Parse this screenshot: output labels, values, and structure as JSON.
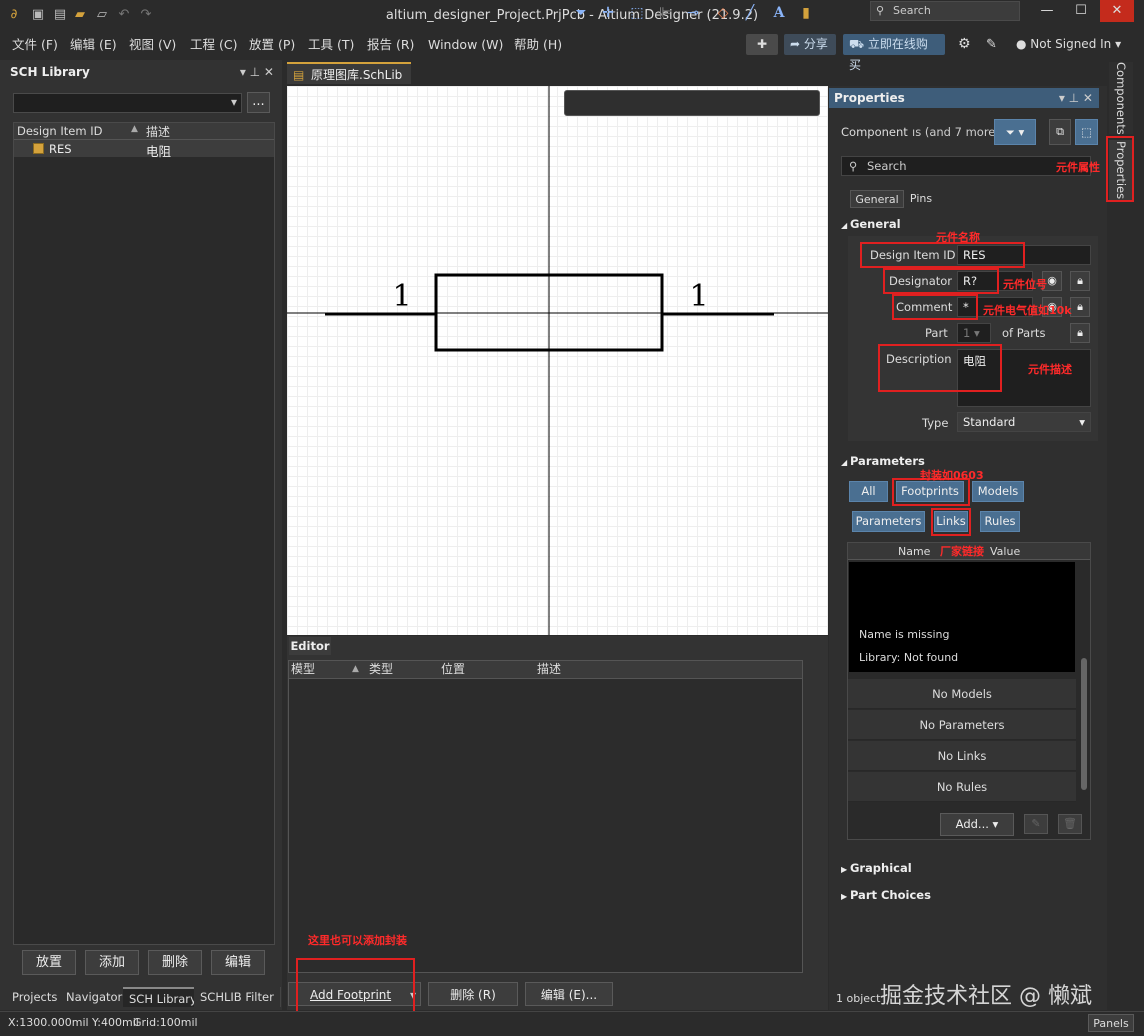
{
  "window": {
    "title": "altium_designer_Project.PrjPcb - Altium Designer (21.9.2)",
    "search_placeholder": "Search"
  },
  "menu": [
    "文件 (F)",
    "编辑 (E)",
    "视图 (V)",
    "工程 (C)",
    "放置 (P)",
    "工具 (T)",
    "报告 (R)",
    "Window (W)",
    "帮助 (H)"
  ],
  "toolbar": {
    "share": "分享",
    "buy": "立即在线购买",
    "user": "Not Signed In"
  },
  "left_panel": {
    "title": "SCH Library",
    "more_button": "...",
    "columns": [
      "Design Item ID",
      "描述"
    ],
    "rows": [
      {
        "id": "RES",
        "desc": "电阻"
      }
    ],
    "buttons": [
      "放置",
      "添加",
      "删除",
      "编辑"
    ],
    "tabs": [
      "Projects",
      "Navigator",
      "SCH Library",
      "SCHLIB Filter"
    ]
  },
  "document": {
    "tab": "原理图库.SchLib *",
    "pin_left": "1",
    "pin_right": "1"
  },
  "editor": {
    "tab": "Editor",
    "columns": [
      "模型",
      "类型",
      "位置",
      "描述"
    ],
    "add_footprint": "Add Footprint",
    "delete": "删除 (R)",
    "edit": "编辑 (E)..."
  },
  "properties": {
    "title": "Properties",
    "component_label": "Component",
    "component_filter": "ıs (and 7 more)",
    "search": "Search",
    "tabs": [
      "General",
      "Pins"
    ],
    "general_header": "General",
    "design_item_id_label": "Design Item ID",
    "design_item_id": "RES",
    "designator_label": "Designator",
    "designator": "R?",
    "comment_label": "Comment",
    "comment": "*",
    "part_label": "Part",
    "part_value": "1",
    "of_parts": "of Parts",
    "description_label": "Description",
    "description": "电阻",
    "type_label": "Type",
    "type": "Standard",
    "parameters_header": "Parameters",
    "filter_buttons_row1": [
      "All",
      "Footprints",
      "Models"
    ],
    "filter_buttons_row2": [
      "Parameters",
      "Links",
      "Rules"
    ],
    "param_columns": [
      "Name",
      "Value"
    ],
    "preview_line1": "Name is missing",
    "preview_line2": "Library: Not found",
    "empty_rows": [
      "No Models",
      "No Parameters",
      "No Links",
      "No Rules"
    ],
    "add_button": "Add...",
    "graphical": "Graphical",
    "part_choices": "Part Choices",
    "selection": "1 object"
  },
  "side_tabs": [
    "Components",
    "Properties"
  ],
  "annotations": {
    "props": "元件属性",
    "name": "元件名称",
    "designator": "元件位号",
    "comment": "元件电气值如10k",
    "description": "元件描述",
    "footprint": "封装如0603",
    "links": "厂家链接",
    "add_here": "这里也可以添加封装"
  },
  "watermark": "掘金技术社区 @ 懒斌",
  "status": {
    "coords": "X:1300.000mil Y:400mil",
    "grid": "Grid:100mil",
    "panels": "Panels"
  }
}
